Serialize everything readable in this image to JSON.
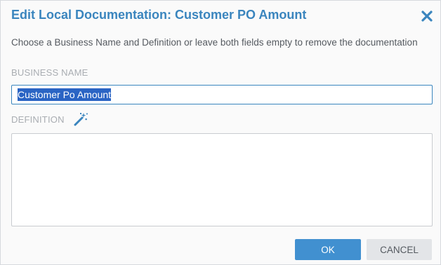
{
  "dialog": {
    "title": "Edit Local Documentation: Customer PO Amount",
    "instructions": "Choose a Business Name and Definition or leave both fields empty to remove the documentation",
    "close_icon": "close-icon"
  },
  "fields": {
    "business_name_label": "BUSINESS NAME",
    "business_name_value": "Customer Po Amount",
    "definition_label": "DEFINITION",
    "definition_value": "",
    "definition_icon": "magic-wand-icon"
  },
  "buttons": {
    "ok_label": "OK",
    "cancel_label": "CANCEL"
  },
  "colors": {
    "accent": "#3a85be",
    "ok_button": "#4190d0",
    "selection": "#2a64c4"
  }
}
